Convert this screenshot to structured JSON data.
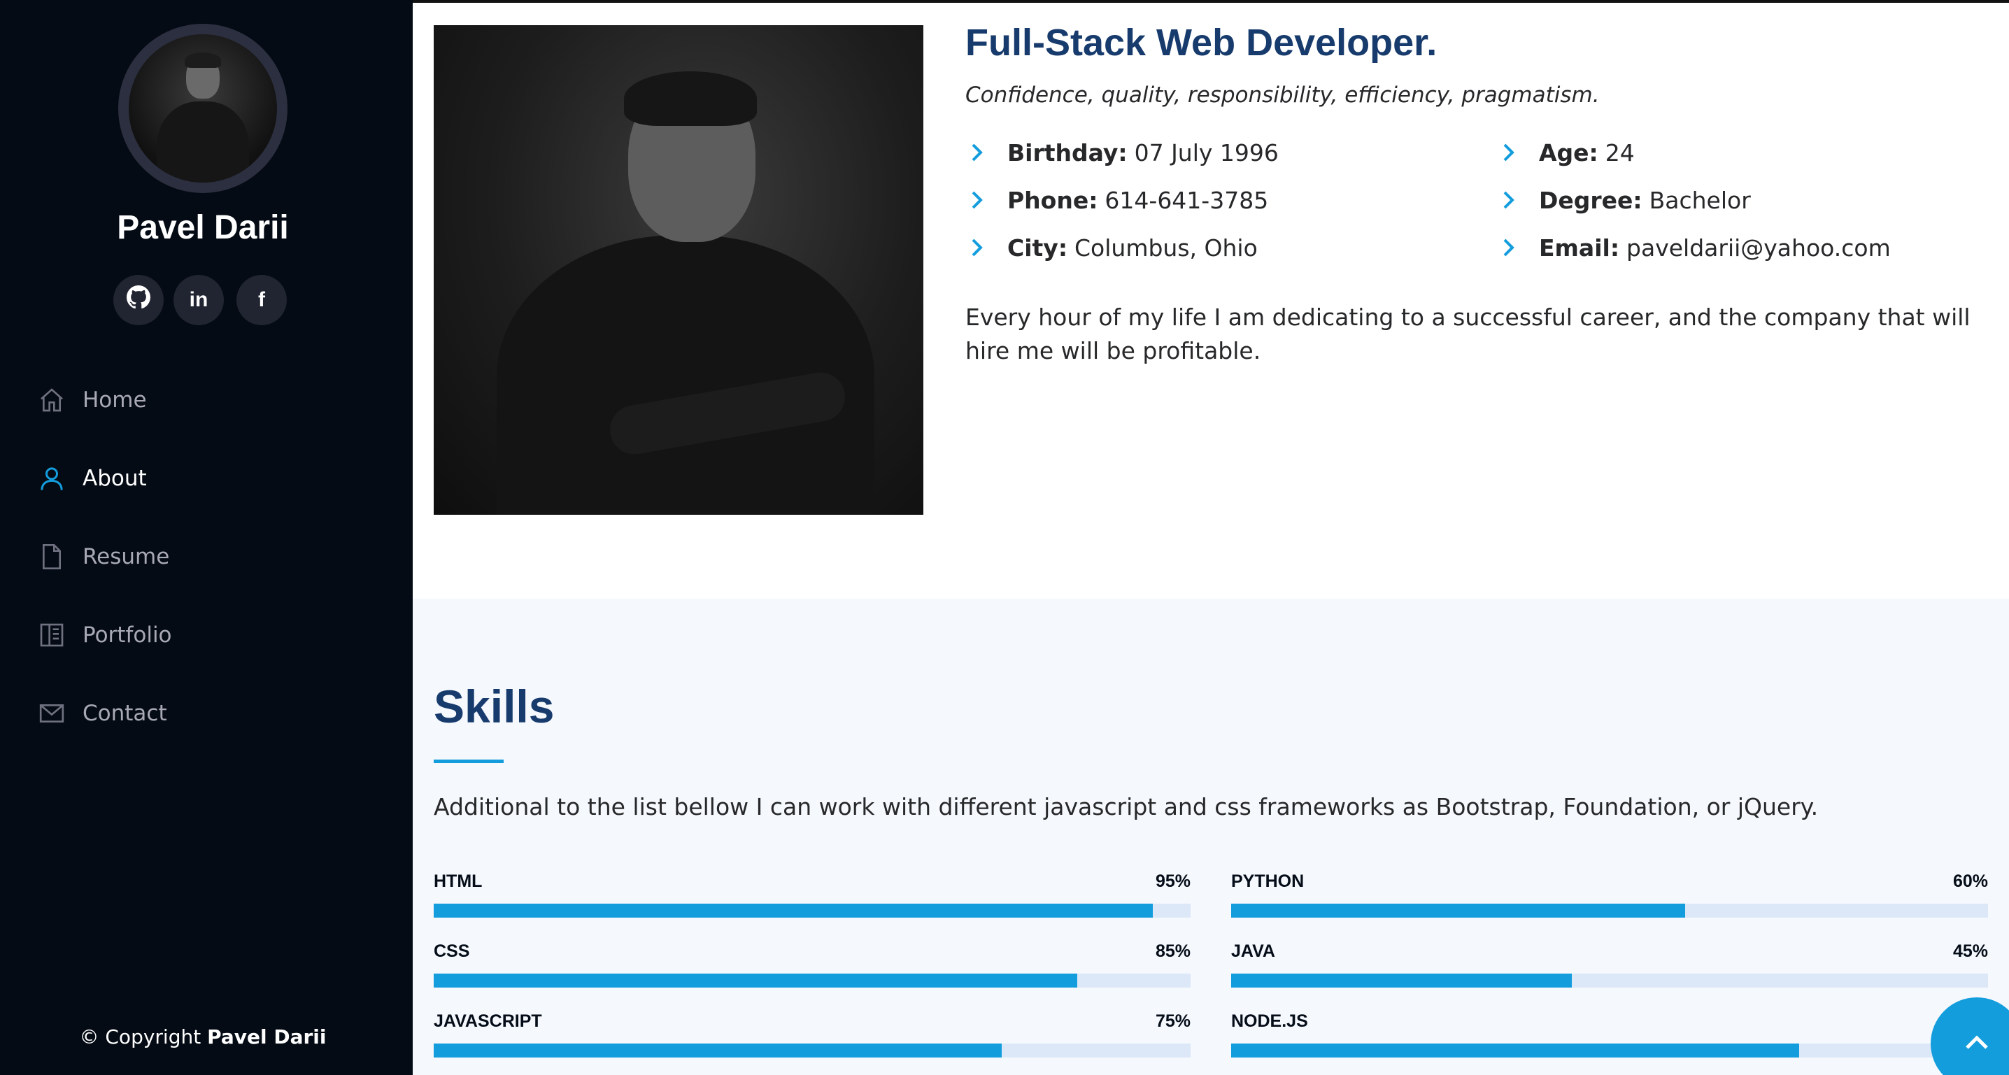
{
  "sidebar": {
    "name": "Pavel Darii",
    "social": [
      {
        "icon": "github-icon"
      },
      {
        "icon": "linkedin-icon",
        "glyph": "in"
      },
      {
        "icon": "facebook-icon",
        "glyph": "f"
      }
    ],
    "nav": [
      {
        "label": "Home",
        "icon": "home-icon"
      },
      {
        "label": "About",
        "icon": "user-icon",
        "active": true
      },
      {
        "label": "Resume",
        "icon": "file-icon"
      },
      {
        "label": "Portfolio",
        "icon": "book-icon"
      },
      {
        "label": "Contact",
        "icon": "envelope-icon"
      }
    ],
    "copyright_prefix": "© Copyright",
    "copyright_name": "Pavel Darii"
  },
  "about": {
    "headline": "Full-Stack Web Developer.",
    "tagline": "Confidence, quality, responsibility, efficiency, pragmatism.",
    "details_left": [
      {
        "label": "Birthday:",
        "value": "07 July 1996"
      },
      {
        "label": "Phone:",
        "value": "614-641-3785"
      },
      {
        "label": "City:",
        "value": "Columbus, Ohio"
      }
    ],
    "details_right": [
      {
        "label": "Age:",
        "value": "24"
      },
      {
        "label": "Degree:",
        "value": "Bachelor"
      },
      {
        "label": "Email:",
        "value": "paveldarii@yahoo.com"
      }
    ],
    "paragraph": "Every hour of my life I am dedicating to a successful career, and the company that will hire me will be profitable."
  },
  "skills": {
    "title": "Skills",
    "intro": "Additional to the list bellow I can work with different javascript and css frameworks as Bootstrap, Foundation, or jQuery.",
    "left": [
      {
        "name": "HTML",
        "value_label": "95%",
        "level": 95
      },
      {
        "name": "CSS",
        "value_label": "85%",
        "level": 85
      },
      {
        "name": "JAVASCRIPT",
        "value_label": "75%",
        "level": 75
      }
    ],
    "right": [
      {
        "name": "PYTHON",
        "value_label": "60%",
        "level": 60
      },
      {
        "name": "JAVA",
        "value_label": "45%",
        "level": 45
      },
      {
        "name": "NODE.JS",
        "value_label": "",
        "level": 75
      }
    ]
  },
  "colors": {
    "sidebar_bg": "#040b14",
    "accent": "#149ddd",
    "heading": "#173b6c",
    "skills_bg": "#f5f8fd"
  }
}
